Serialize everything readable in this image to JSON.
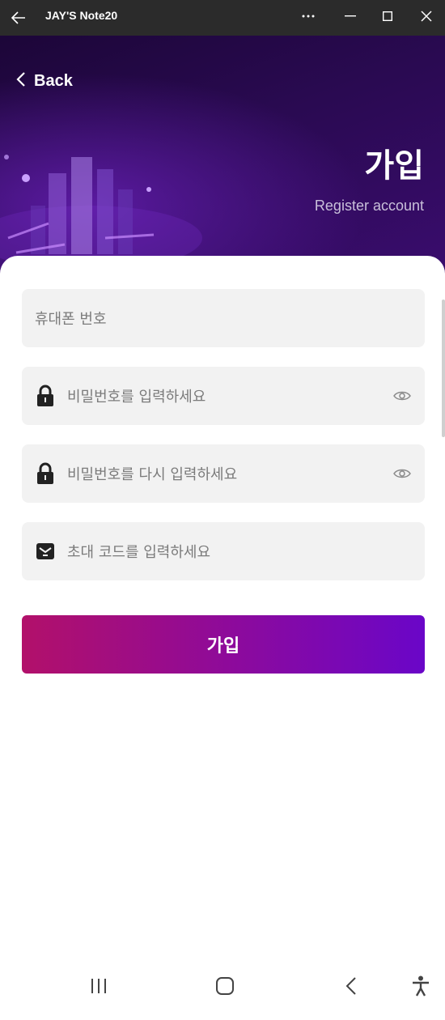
{
  "window": {
    "title": "JAY'S Note20",
    "icons": [
      "back-arrow-icon",
      "more-icon",
      "minimize-icon",
      "maximize-icon",
      "close-icon"
    ]
  },
  "header": {
    "back_label": "Back",
    "title": "가입",
    "subtitle": "Register account"
  },
  "form": {
    "phone_placeholder": "휴대폰 번호",
    "password_placeholder": "비밀번호를 입력하세요",
    "password_confirm_placeholder": "비밀번호를 다시 입력하세요",
    "invite_placeholder": "초대 코드를 입력하세요",
    "submit_label": "가입"
  },
  "nav": {
    "icons": [
      "recents-icon",
      "home-icon",
      "back-icon",
      "accessibility-icon"
    ]
  },
  "colors": {
    "header_bg": "#2a0a52",
    "button_start": "#b2106a",
    "button_end": "#6a06c8",
    "field_bg": "#f2f2f2"
  }
}
